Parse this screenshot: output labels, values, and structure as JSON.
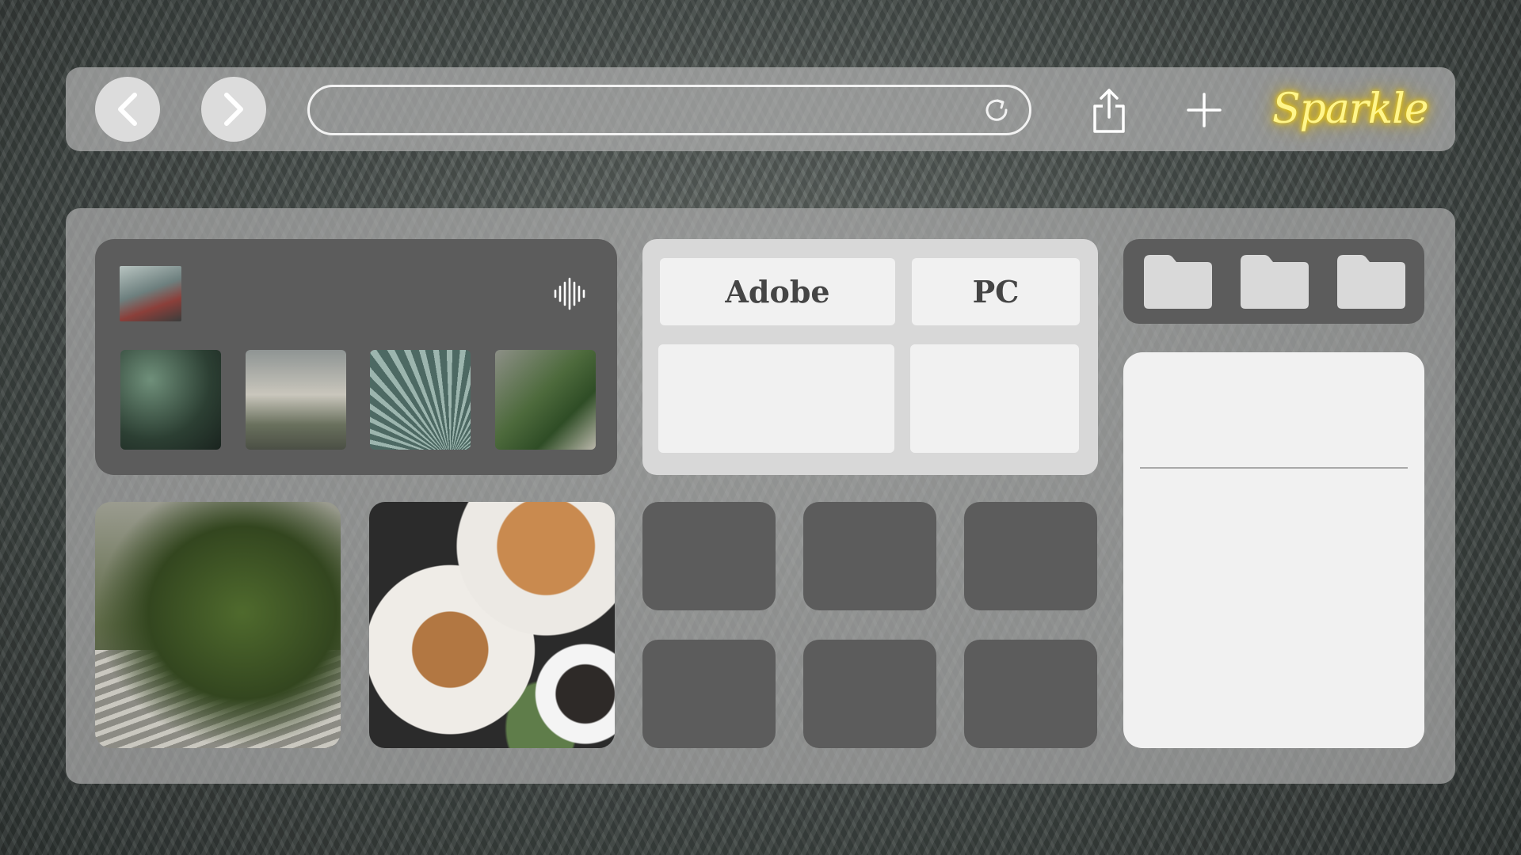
{
  "browser": {
    "brand": "Sparkle",
    "address": {
      "value": "",
      "placeholder": ""
    },
    "icons": {
      "back": "chevron-left-icon",
      "forward": "chevron-right-icon",
      "reload": "reload-icon",
      "share": "share-icon",
      "new_tab": "plus-icon"
    }
  },
  "apps": {
    "tiles": [
      {
        "label": "Adobe"
      },
      {
        "label": "PC"
      },
      {
        "label": ""
      },
      {
        "label": ""
      }
    ]
  },
  "music": {
    "icon": "sound-wave-icon"
  },
  "colors": {
    "brand_glow": "#fff58a",
    "panel_dark": "#5c5c5c",
    "panel_light": "#f1f1f1"
  }
}
